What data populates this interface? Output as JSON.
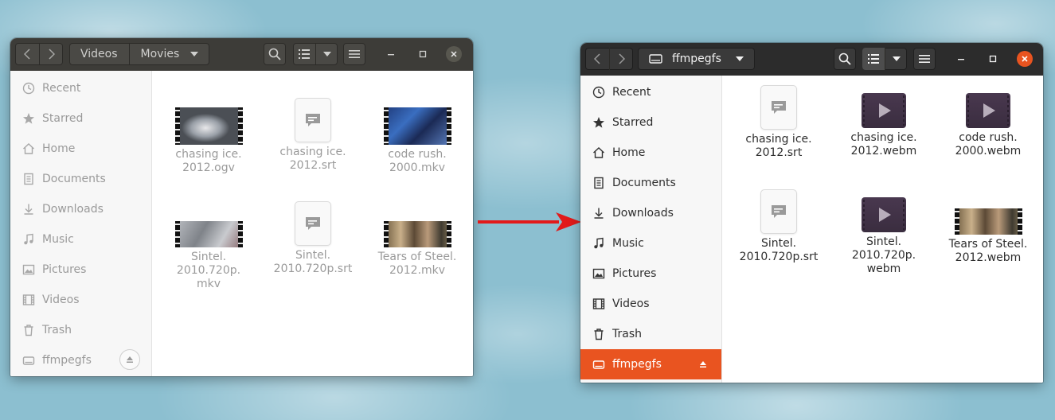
{
  "colors": {
    "accent": "#e95420",
    "arrow": "#e21a1a"
  },
  "left_window": {
    "breadcrumb": [
      "Videos",
      "Movies"
    ],
    "sidebar": [
      {
        "label": "Recent",
        "icon": "clock-icon"
      },
      {
        "label": "Starred",
        "icon": "star-icon"
      },
      {
        "label": "Home",
        "icon": "home-icon"
      },
      {
        "label": "Documents",
        "icon": "document-icon"
      },
      {
        "label": "Downloads",
        "icon": "download-icon"
      },
      {
        "label": "Music",
        "icon": "music-icon"
      },
      {
        "label": "Pictures",
        "icon": "picture-icon"
      },
      {
        "label": "Videos",
        "icon": "film-icon"
      },
      {
        "label": "Trash",
        "icon": "trash-icon"
      },
      {
        "label": "ffmpegfs",
        "icon": "drive-icon"
      }
    ],
    "files": [
      {
        "line1": "chasing ice.",
        "line2": "2012.ogv",
        "line3": "",
        "type": "video-thumbnail"
      },
      {
        "line1": "chasing ice.",
        "line2": "2012.srt",
        "line3": "",
        "type": "subtitle"
      },
      {
        "line1": "code rush.",
        "line2": "2000.mkv",
        "line3": "",
        "type": "video-thumbnail"
      },
      {
        "line1": "Sintel.",
        "line2": "2010.720p.",
        "line3": "mkv",
        "type": "video-thumbnail"
      },
      {
        "line1": "Sintel.",
        "line2": "2010.720p.srt",
        "line3": "",
        "type": "subtitle"
      },
      {
        "line1": "Tears of Steel.",
        "line2": "2012.mkv",
        "line3": "",
        "type": "video-thumbnail"
      }
    ]
  },
  "right_window": {
    "location": "ffmpegfs",
    "sidebar": [
      {
        "label": "Recent",
        "icon": "clock-icon"
      },
      {
        "label": "Starred",
        "icon": "star-icon"
      },
      {
        "label": "Home",
        "icon": "home-icon"
      },
      {
        "label": "Documents",
        "icon": "document-icon"
      },
      {
        "label": "Downloads",
        "icon": "download-icon"
      },
      {
        "label": "Music",
        "icon": "music-icon"
      },
      {
        "label": "Pictures",
        "icon": "picture-icon"
      },
      {
        "label": "Videos",
        "icon": "film-icon"
      },
      {
        "label": "Trash",
        "icon": "trash-icon"
      },
      {
        "label": "ffmpegfs",
        "icon": "drive-icon",
        "active": true
      }
    ],
    "files": [
      {
        "line1": "chasing ice.",
        "line2": "2012.srt",
        "line3": "",
        "type": "subtitle"
      },
      {
        "line1": "chasing ice.",
        "line2": "2012.webm",
        "line3": "",
        "type": "video-generic"
      },
      {
        "line1": "code rush.",
        "line2": "2000.webm",
        "line3": "",
        "type": "video-generic"
      },
      {
        "line1": "Sintel.",
        "line2": "2010.720p.srt",
        "line3": "",
        "type": "subtitle"
      },
      {
        "line1": "Sintel.",
        "line2": "2010.720p.",
        "line3": "webm",
        "type": "video-generic"
      },
      {
        "line1": "Tears of Steel.",
        "line2": "2012.webm",
        "line3": "",
        "type": "video-thumbnail"
      }
    ]
  }
}
